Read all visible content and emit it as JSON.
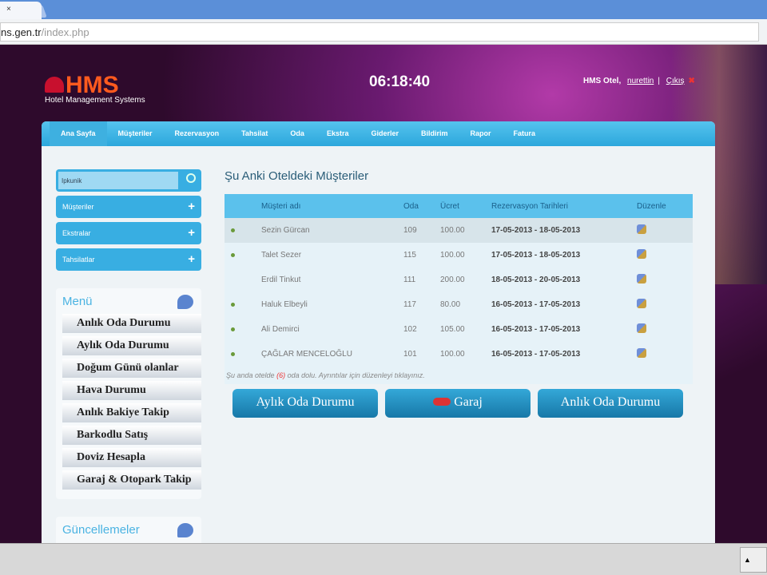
{
  "browser": {
    "tab_close": "×",
    "url_host": "ns.gen.tr",
    "url_path": "/index.php"
  },
  "header": {
    "logo": "HMS",
    "logo_sub": "Hotel Management Systems",
    "clock": "06:18:40",
    "hotel": "HMS Otel,",
    "user": "nurettin",
    "sep": "|",
    "logout": "Çıkış",
    "logout_icon": "✖"
  },
  "nav": [
    "Ana Sayfa",
    "Müşteriler",
    "Rezervasyon",
    "Tahsilat",
    "Oda",
    "Ekstra",
    "Giderler",
    "Bildirim",
    "Rapor",
    "Fatura"
  ],
  "sidebar": {
    "search_value": "Ipkunik",
    "buttons": [
      "Müşteriler",
      "Ekstralar",
      "Tahsilatlar"
    ],
    "plus": "+",
    "menu_title": "Menü",
    "menu": [
      "Anlık Oda Durumu",
      "Aylık Oda Durumu",
      "Doğum Günü olanlar",
      "Hava Durumu",
      "Anlık Bakiye Takip",
      "Barkodlu Satış",
      "Doviz Hesapla",
      "Garaj & Otopark Takip"
    ],
    "updates_title": "Güncellemeler"
  },
  "main": {
    "title": "Şu Anki Oteldeki Müşteriler",
    "columns": [
      "Müşteri adı",
      "Oda",
      "Ücret",
      "Rezervasyon Tarihleri",
      "Düzenle"
    ],
    "rows": [
      {
        "name": "Sezin Gürcan",
        "room": "109",
        "fee": "100.00",
        "dates": "17-05-2013 - 18-05-2013",
        "dot": true
      },
      {
        "name": "Talet Sezer",
        "room": "115",
        "fee": "100.00",
        "dates": "17-05-2013 - 18-05-2013",
        "dot": true
      },
      {
        "name": "Erdil Tinkut",
        "room": "111",
        "fee": "200.00",
        "dates": "18-05-2013 - 20-05-2013",
        "dot": false
      },
      {
        "name": "Haluk Elbeyli",
        "room": "117",
        "fee": "80.00",
        "dates": "16-05-2013 - 17-05-2013",
        "dot": true
      },
      {
        "name": "Ali Demirci",
        "room": "102",
        "fee": "105.00",
        "dates": "16-05-2013 - 17-05-2013",
        "dot": true
      },
      {
        "name": "ÇAĞLAR MENCELOĞLU",
        "room": "101",
        "fee": "100.00",
        "dates": "16-05-2013 - 17-05-2013",
        "dot": true
      }
    ],
    "note_pre": "Şu anda otelde",
    "note_count": "(6)",
    "note_post": "oda dolu. Ayrıntılar için düzenleyi tıklayınız.",
    "buttons": [
      "Aylık Oda Durumu",
      "Garaj",
      "Anlık Oda Durumu"
    ]
  },
  "taskbar": {
    "tray": "▲"
  }
}
